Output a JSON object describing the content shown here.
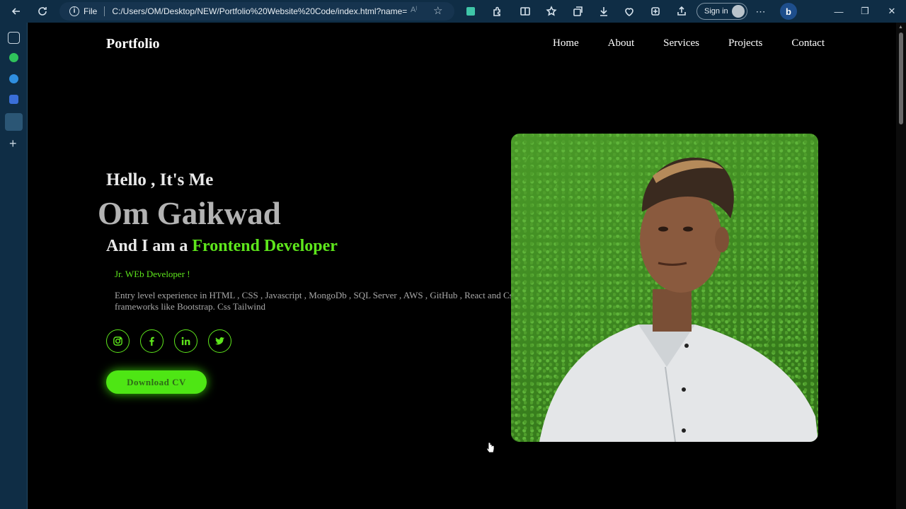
{
  "browser": {
    "address_prefix": "File",
    "url": "C:/Users/OM/Desktop/NEW/Portfolio%20Website%20Code/index.html?name=...",
    "sign_in_label": "Sign in"
  },
  "colors": {
    "accent": "#5ee61c",
    "background": "#000000",
    "chrome": "#0f2d45"
  },
  "header": {
    "logo": "Portfolio",
    "nav": [
      "Home",
      "About",
      "Services",
      "Projects",
      "Contact"
    ]
  },
  "hero": {
    "greeting": "Hello , It's Me",
    "name": "Om Gaikwad",
    "role_prefix": "And I am a",
    "role_highlight": "Frontend Developer",
    "subtitle": "Jr. WEb Developer !",
    "description": "Entry level experience in HTML , CSS , Javascript , MongoDb , SQL Server , AWS , GitHub , React and Css frameworks like Bootstrap. Css Tailwind",
    "socials": [
      "instagram-icon",
      "facebook-icon",
      "linkedin-icon",
      "twitter-icon"
    ],
    "cta_label": "Download CV",
    "photo": "portrait photo on green grass background"
  }
}
